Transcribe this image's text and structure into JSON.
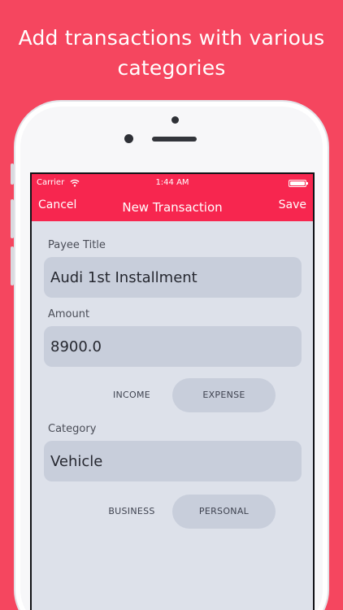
{
  "headline": "Add transactions with various categories",
  "status_bar": {
    "carrier": "Carrier",
    "time": "1:44 AM"
  },
  "navbar": {
    "cancel": "Cancel",
    "title": "New Transaction",
    "save": "Save"
  },
  "form": {
    "payee": {
      "label": "Payee Title",
      "value": "Audi 1st Installment"
    },
    "amount": {
      "label": "Amount",
      "value": "8900.0"
    },
    "type_toggle": {
      "options": [
        "INCOME",
        "EXPENSE"
      ],
      "selected": "EXPENSE"
    },
    "category": {
      "label": "Category",
      "value": "Vehicle"
    },
    "scope_toggle": {
      "options": [
        "BUSINESS",
        "PERSONAL"
      ],
      "selected": "PERSONAL"
    }
  },
  "colors": {
    "brand": "#f5465f",
    "navbar": "#f7264f",
    "form_bg": "#dde1ea",
    "field_bg": "#c8cedb"
  }
}
